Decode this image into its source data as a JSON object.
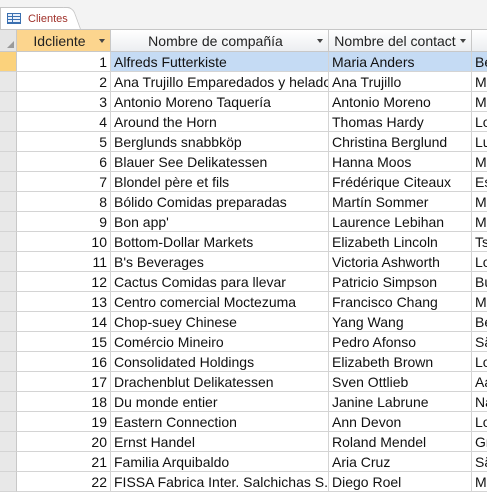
{
  "tab": {
    "label": "Clientes"
  },
  "columns": [
    {
      "label": "Idcliente"
    },
    {
      "label": "Nombre de compañía"
    },
    {
      "label": "Nombre del contact"
    },
    {
      "label": ""
    }
  ],
  "rows": [
    [
      "1",
      "Alfreds Futterkiste",
      "Maria Anders",
      "Be"
    ],
    [
      "2",
      "Ana Trujillo Emparedados y helados",
      "Ana Trujillo",
      "M"
    ],
    [
      "3",
      "Antonio Moreno Taquería",
      "Antonio Moreno",
      "M"
    ],
    [
      "4",
      "Around the Horn",
      "Thomas Hardy",
      "Lo"
    ],
    [
      "5",
      "Berglunds snabbköp",
      "Christina Berglund",
      "Lu"
    ],
    [
      "6",
      "Blauer See Delikatessen",
      "Hanna Moos",
      "M"
    ],
    [
      "7",
      "Blondel père et fils",
      "Frédérique Citeaux",
      "Es"
    ],
    [
      "8",
      "Bólido Comidas preparadas",
      "Martín Sommer",
      "M"
    ],
    [
      "9",
      "Bon app'",
      "Laurence Lebihan",
      "M"
    ],
    [
      "10",
      "Bottom-Dollar Markets",
      "Elizabeth Lincoln",
      "Ts"
    ],
    [
      "11",
      "B's Beverages",
      "Victoria Ashworth",
      "Lo"
    ],
    [
      "12",
      "Cactus Comidas para llevar",
      "Patricio Simpson",
      "Bu"
    ],
    [
      "13",
      "Centro comercial Moctezuma",
      "Francisco Chang",
      "M"
    ],
    [
      "14",
      "Chop-suey Chinese",
      "Yang Wang",
      "Be"
    ],
    [
      "15",
      "Comércio Mineiro",
      "Pedro Afonso",
      "Sã"
    ],
    [
      "16",
      "Consolidated Holdings",
      "Elizabeth Brown",
      "Lo"
    ],
    [
      "17",
      "Drachenblut Delikatessen",
      "Sven Ottlieb",
      "Aa"
    ],
    [
      "18",
      "Du monde entier",
      "Janine Labrune",
      "Na"
    ],
    [
      "19",
      "Eastern Connection",
      "Ann Devon",
      "Lo"
    ],
    [
      "20",
      "Ernst Handel",
      "Roland Mendel",
      "Gr"
    ],
    [
      "21",
      "Familia Arquibaldo",
      "Aria Cruz",
      "Sã"
    ],
    [
      "22",
      "FISSA Fabrica Inter. Salchichas S.A.",
      "Diego Roel",
      "M"
    ]
  ]
}
